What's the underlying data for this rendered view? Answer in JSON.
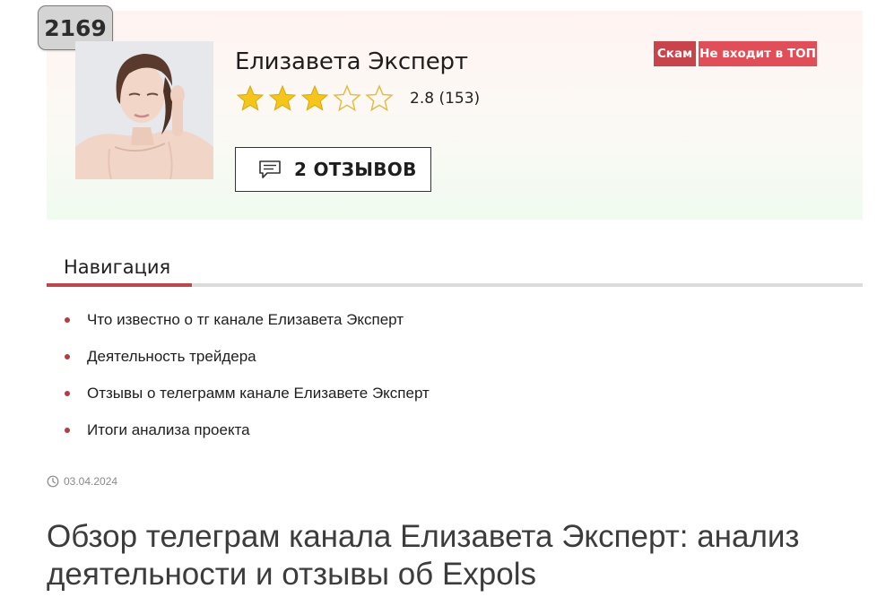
{
  "card": {
    "rank": "2169",
    "name": "Елизавета Эксперт",
    "rating": {
      "value": 2.8,
      "max": 5,
      "text": "2.8 (153)"
    },
    "reviews_button_label": "2 ОТЗЫВОВ",
    "tags": [
      "Скам",
      "Не входит в ТОП"
    ],
    "colors": {
      "star_fill": "#f5c518",
      "tag_scam": "#c9434a",
      "tag_top": "#e24e57"
    }
  },
  "navigation": {
    "title": "Навигация",
    "items": [
      {
        "label": "Что известно о тг канале Елизавета Эксперт"
      },
      {
        "label": "Деятельность трейдера"
      },
      {
        "label": "Отзывы о телеграмм канале Елизавете Эксперт"
      },
      {
        "label": "Итоги анализа проекта"
      }
    ],
    "colors": {
      "accent": "#c0464b"
    }
  },
  "article": {
    "date": "03.04.2024",
    "title": "Обзор телеграм канала Елизавета Эксперт: анализ деятельности и отзывы об Expols"
  }
}
